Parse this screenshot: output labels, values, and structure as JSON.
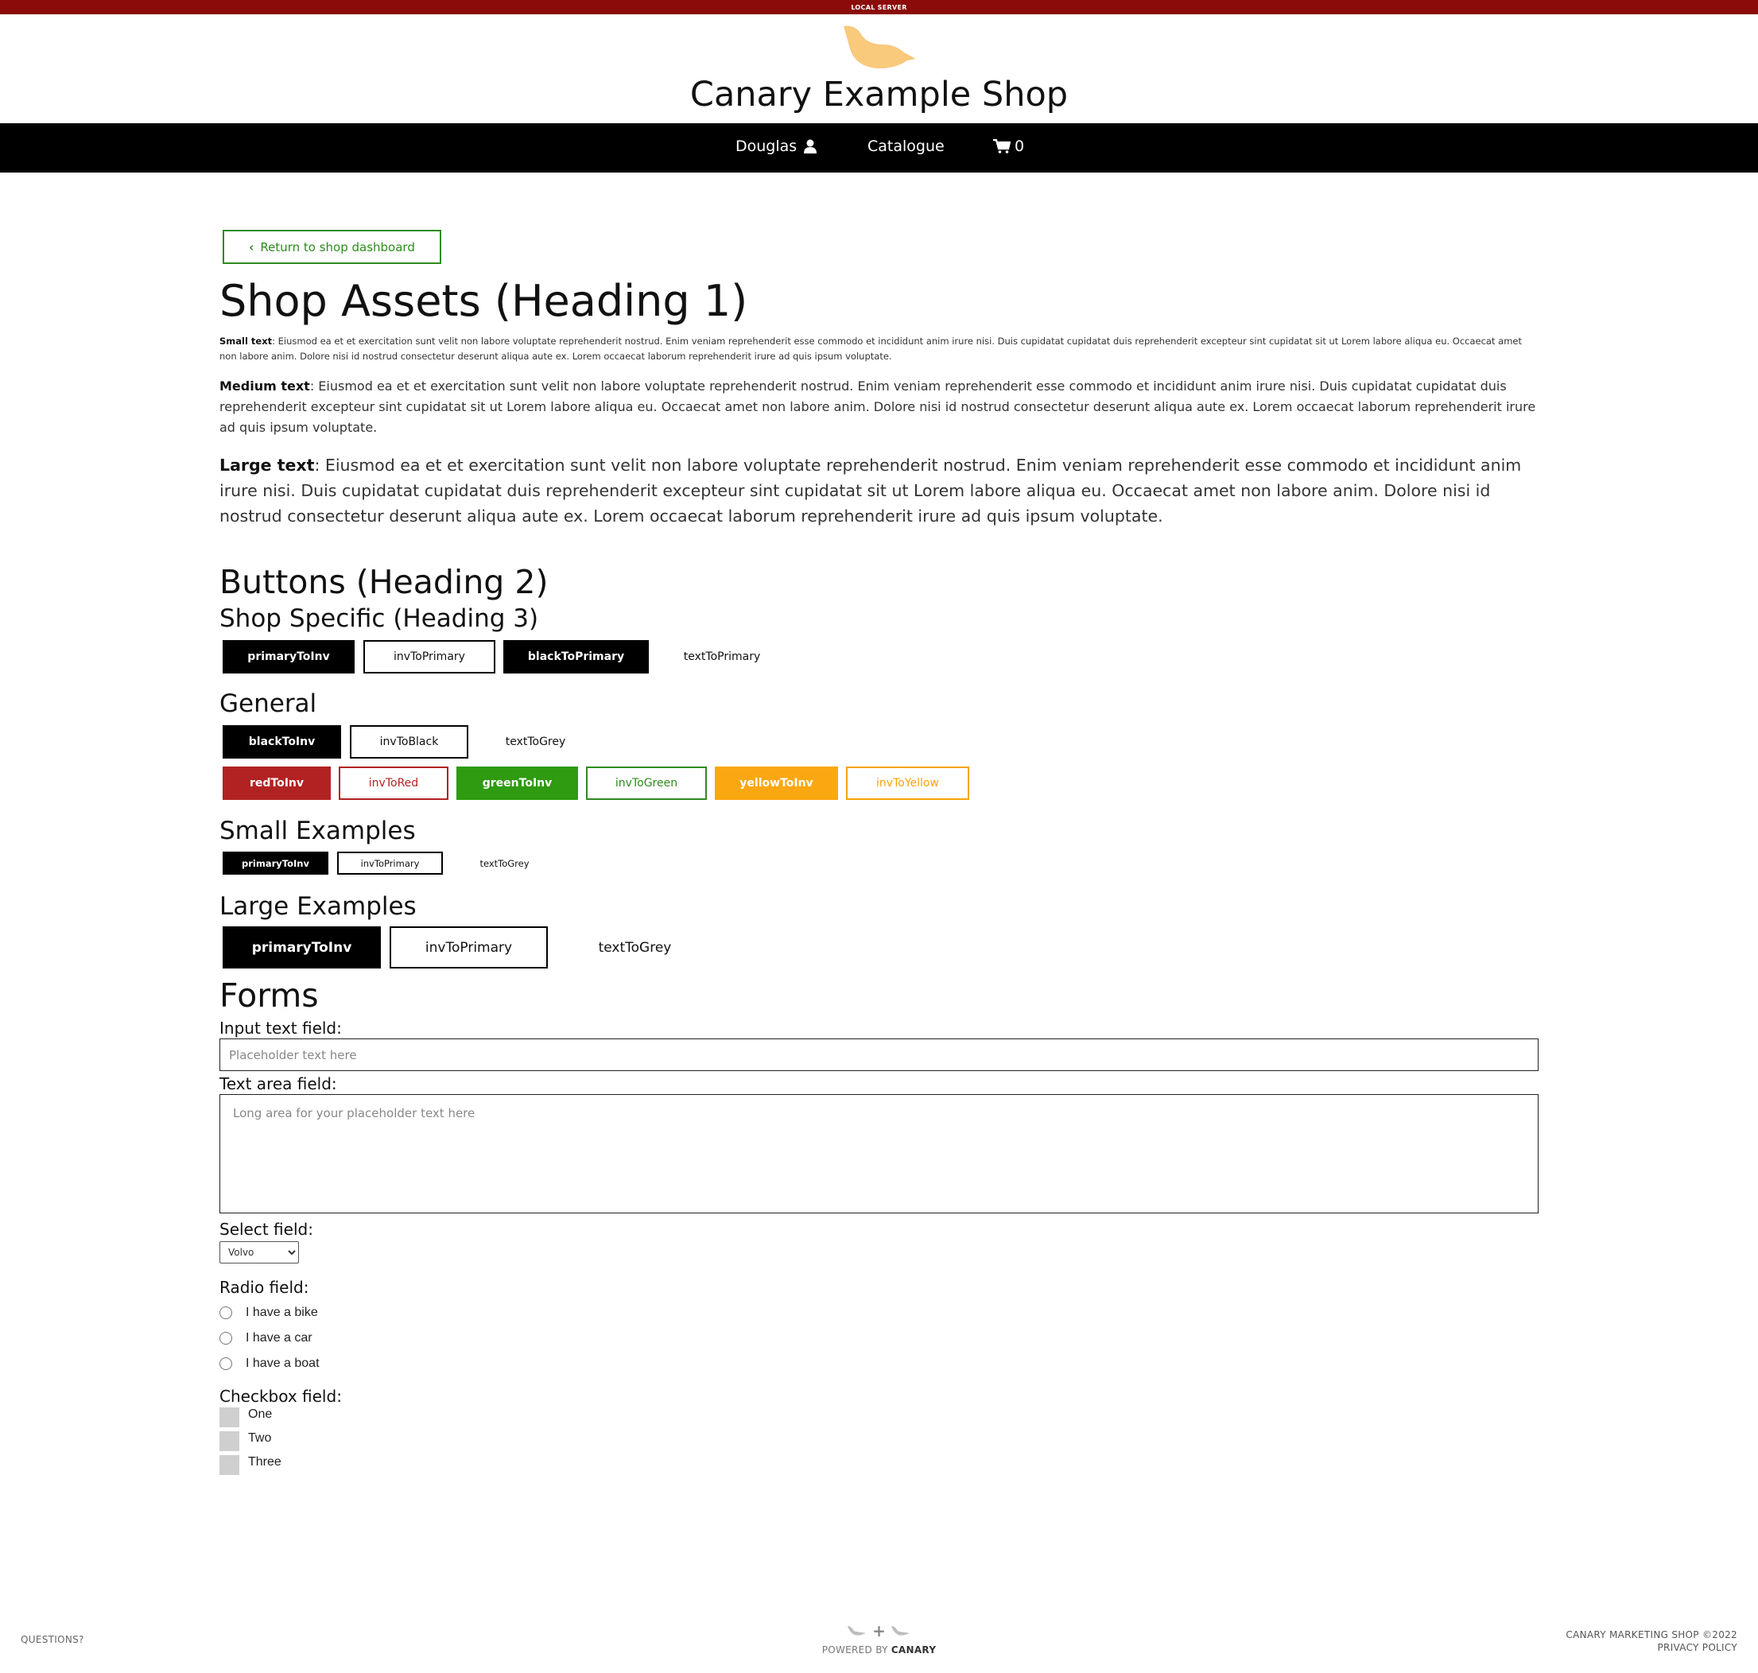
{
  "topbar": {
    "label": "LOCAL SERVER"
  },
  "header": {
    "title": "Canary Example Shop",
    "logo_icon": "canary-bird-icon"
  },
  "nav": {
    "user": "Douglas",
    "catalogue": "Catalogue",
    "cart_count": "0"
  },
  "back_button": {
    "label": "Return to shop dashboard"
  },
  "assets": {
    "title": "Shop Assets (Heading 1)",
    "small_label": "Small text",
    "small_text": ": Eiusmod ea et et exercitation sunt velit non labore voluptate reprehenderit nostrud. Enim veniam reprehenderit esse commodo et incididunt anim irure nisi. Duis cupidatat cupidatat duis reprehenderit excepteur sint cupidatat sit ut Lorem labore aliqua eu. Occaecat amet non labore anim. Dolore nisi id nostrud consectetur deserunt aliqua aute ex. Lorem occaecat laborum reprehenderit irure ad quis ipsum voluptate.",
    "medium_label": "Medium text",
    "medium_text": ": Eiusmod ea et et exercitation sunt velit non labore voluptate reprehenderit nostrud. Enim veniam reprehenderit esse commodo et incididunt anim irure nisi. Duis cupidatat cupidatat duis reprehenderit excepteur sint cupidatat sit ut Lorem labore aliqua eu. Occaecat amet non labore anim. Dolore nisi id nostrud consectetur deserunt aliqua aute ex. Lorem occaecat laborum reprehenderit irure ad quis ipsum voluptate.",
    "large_label": "Large text",
    "large_text": ": Eiusmod ea et et exercitation sunt velit non labore voluptate reprehenderit nostrud. Enim veniam reprehenderit esse commodo et incididunt anim irure nisi. Duis cupidatat cupidatat duis reprehenderit excepteur sint cupidatat sit ut Lorem labore aliqua eu. Occaecat amet non labore anim. Dolore nisi id nostrud consectetur deserunt aliqua aute ex. Lorem occaecat laborum reprehenderit irure ad quis ipsum voluptate."
  },
  "buttons": {
    "title": "Buttons (Heading 2)",
    "shop_specific": {
      "title": "Shop Specific (Heading 3)",
      "primaryToInv": "primaryToInv",
      "invToPrimary": "invToPrimary",
      "blackToPrimary": "blackToPrimary",
      "textToPrimary": "textToPrimary"
    },
    "general": {
      "title": "General",
      "blackToInv": "blackToInv",
      "invToBlack": "invToBlack",
      "textToGrey": "textToGrey",
      "redToInv": "redToInv",
      "invToRed": "invToRed",
      "greenToInv": "greenToInv",
      "invToGreen": "invToGreen",
      "yellowToInv": "yellowToInv",
      "invToYellow": "invToYellow"
    },
    "small": {
      "title": "Small Examples",
      "primaryToInv": "primaryToInv",
      "invToPrimary": "invToPrimary",
      "textToGrey": "textToGrey"
    },
    "large": {
      "title": "Large Examples",
      "primaryToInv": "primaryToInv",
      "invToPrimary": "invToPrimary",
      "textToGrey": "textToGrey"
    }
  },
  "forms": {
    "title": "Forms",
    "input_label": "Input text field:",
    "input_placeholder": "Placeholder text here",
    "textarea_label": "Text area field:",
    "textarea_placeholder": "Long area for your placeholder text here",
    "select_label": "Select field:",
    "select_value": "Volvo",
    "radio_label": "Radio field:",
    "radios": [
      "I have a bike",
      "I have a car",
      "I have a boat"
    ],
    "checkbox_label": "Checkbox field:",
    "checkboxes": [
      "One",
      "Two",
      "Three"
    ]
  },
  "footer": {
    "questions": "QUESTIONS?",
    "powered_by": "POWERED BY ",
    "brand": "CANARY",
    "copyright": "CANARY MARKETING SHOP ©2022",
    "privacy": "PRIVACY POLICY"
  },
  "colors": {
    "topbar": "#8b0a0a",
    "nav": "#000000",
    "logo": "#f9c97c",
    "green": "#2e9b10",
    "red": "#b22222",
    "yellow": "#fba711"
  }
}
